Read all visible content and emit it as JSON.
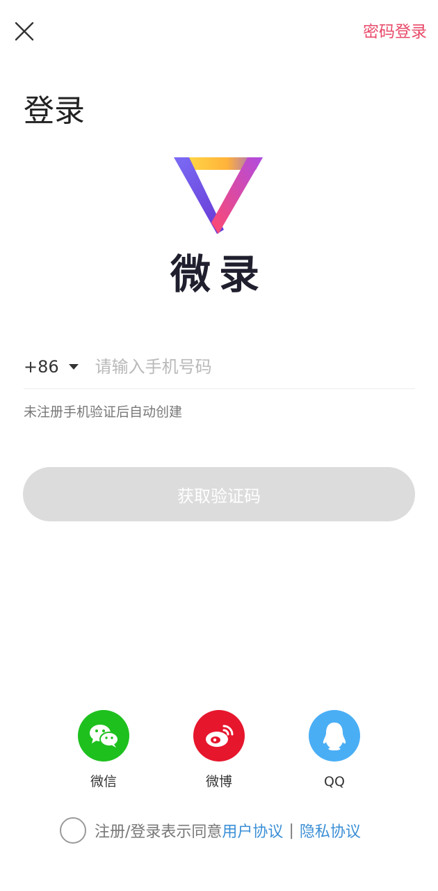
{
  "header": {
    "password_login": "密码登录"
  },
  "page": {
    "title": "登录"
  },
  "logo": {
    "text": "微录"
  },
  "phone": {
    "country_code": "+86",
    "placeholder": "请输入手机号码",
    "value": "",
    "hint": "未注册手机验证后自动创建"
  },
  "primary_button": {
    "label": "获取验证码",
    "enabled": false
  },
  "social": {
    "items": [
      {
        "label": "微信",
        "icon": "wechat-icon",
        "color": "#1ec01e"
      },
      {
        "label": "微博",
        "icon": "weibo-icon",
        "color": "#e6162d"
      },
      {
        "label": "QQ",
        "icon": "qq-icon",
        "color": "#4aaef5"
      }
    ]
  },
  "agreement": {
    "prefix": "注册/登录表示同意",
    "user_agreement": "用户协议",
    "separator": "|",
    "privacy_policy": "隐私协议",
    "checked": false
  },
  "colors": {
    "accent_pink": "#e84a6a",
    "link_blue": "#3b8fd6",
    "disabled_button": "#dcdcdc"
  }
}
